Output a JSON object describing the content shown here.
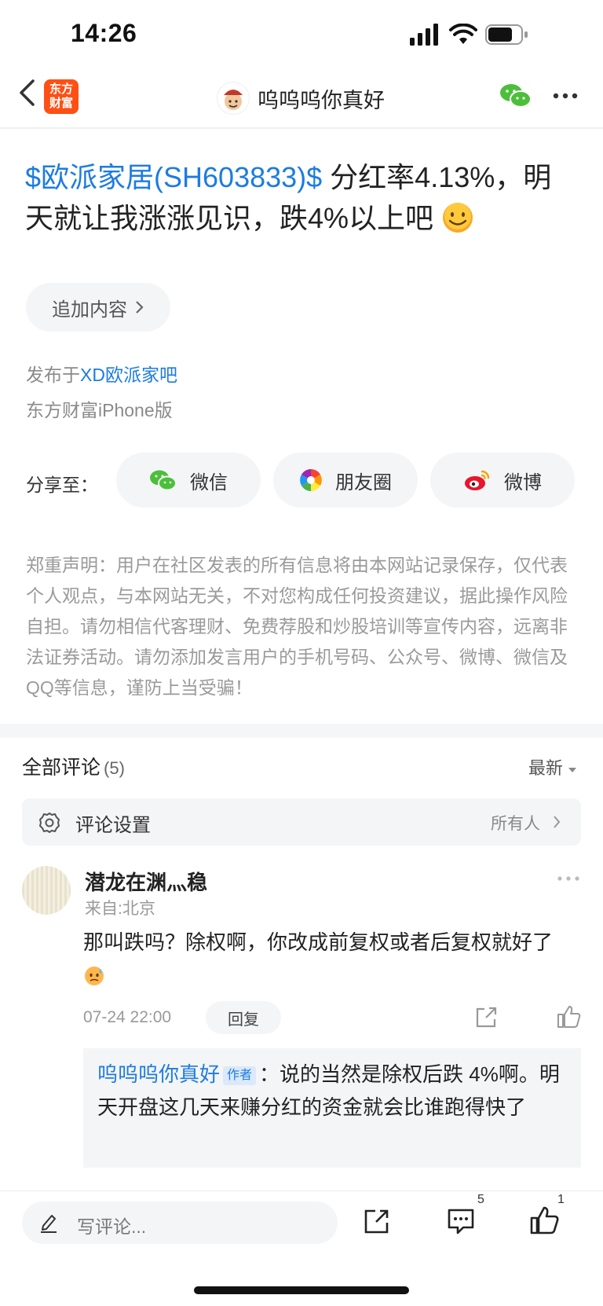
{
  "status_bar": {
    "time": "14:26"
  },
  "nav": {
    "app_logo_line1": "东方",
    "app_logo_line2": "财富",
    "title": "呜呜呜你真好"
  },
  "post": {
    "stock_link": "$欧派家居(SH603833)$",
    "text": "  分红率4.13%，明天就让我涨涨见识，跌4%以上吧",
    "emoji": "smiling-face-emoji",
    "add_content_label": "追加内容",
    "published_prefix": "发布于",
    "bar_name": "XD欧派家吧",
    "client": "东方财富iPhone版"
  },
  "share": {
    "label": "分享至：",
    "wechat": "微信",
    "moments": "朋友圈",
    "weibo": "微博"
  },
  "disclaimer": "郑重声明：用户在社区发表的所有信息将由本网站记录保存，仅代表个人观点，与本网站无关，不对您构成任何投资建议，据此操作风险自担。请勿相信代客理财、免费荐股和炒股培训等宣传内容，远离非法证券活动。请勿添加发言用户的手机号码、公众号、微博、微信及QQ等信息，谨防上当受骗！",
  "comments": {
    "header": "全部评论",
    "count": "(5)",
    "sort": "最新",
    "settings_label": "评论设置",
    "settings_value": "所有人",
    "items": [
      {
        "author": "潜龙在渊灬稳",
        "location": "来自:北京",
        "text": "那叫跌吗？除权啊，你改成前复权或者后复权就好了",
        "time": "07-24 22:00",
        "reply_label": "回复",
        "reply": {
          "name": "呜呜呜你真好",
          "tag": "作者",
          "sep": "：",
          "text": "说的当然是除权后跌 4%啊。明天开盘这几天来赚分红的资金就会比谁跑得快了"
        }
      }
    ]
  },
  "bottom_bar": {
    "placeholder": "写评论...",
    "comment_count": "5",
    "like_count": "1"
  },
  "colors": {
    "link": "#1d7ce0",
    "brand": "#ff4f14",
    "wechat": "#4cbf3a",
    "weibo": "#e6162d"
  }
}
